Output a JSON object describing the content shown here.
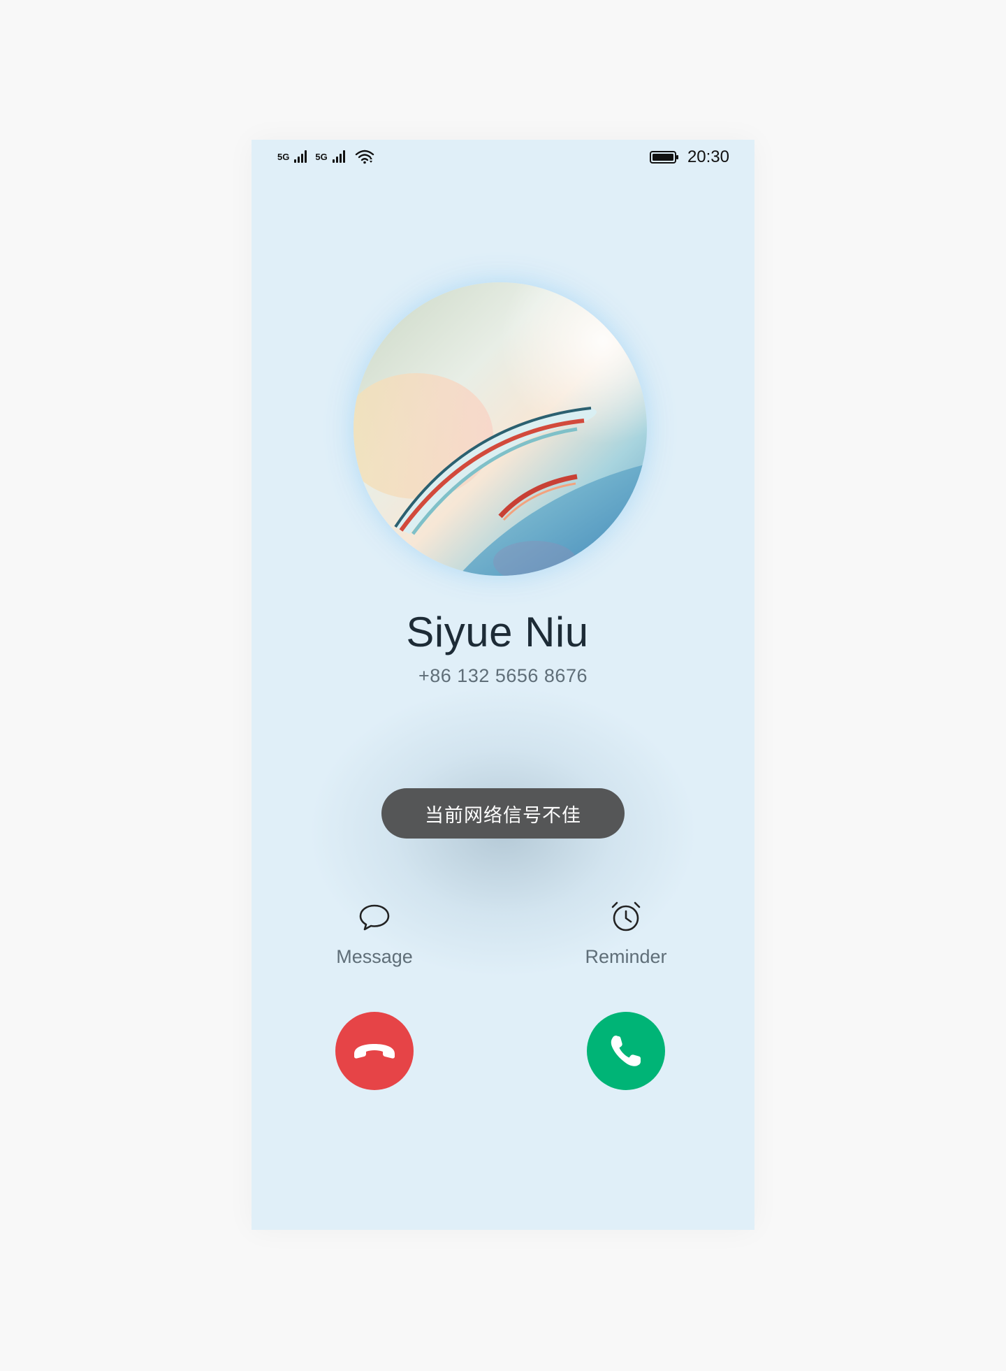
{
  "status_bar": {
    "sim1_network": "5G",
    "sim2_network": "5G",
    "time": "20:30",
    "icons": [
      "signal-icon",
      "signal-icon",
      "wifi-icon",
      "battery-icon"
    ]
  },
  "caller": {
    "name": "Siyue Niu",
    "number": "+86 132 5656 8676"
  },
  "toast": {
    "text": "当前网络信号不佳"
  },
  "actions": {
    "message_label": "Message",
    "reminder_label": "Reminder"
  },
  "call_buttons": {
    "decline_icon": "phone-hangup-icon",
    "answer_icon": "phone-icon"
  },
  "colors": {
    "background": "#e0eff8",
    "decline": "#e64447",
    "answer": "#00b476",
    "toast": "#555657"
  }
}
